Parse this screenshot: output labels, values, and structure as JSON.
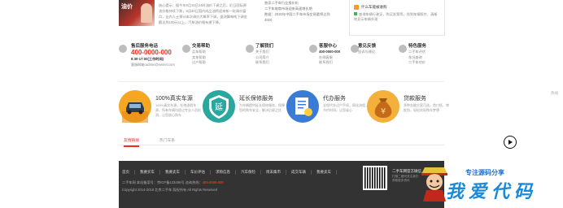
{
  "news": {
    "thumb_label": "油价",
    "body": "核心提示：据今年9月16日24时油价下调之后，近日国际原油价格持续下跌，9月30日国内成品油将迎来新一轮调价窗口，业内人士预计本次调价大概率下调，据测算每吨下调金额达到100元以上，汽柴油价格有望下降。",
    "mid_lines": [
      "独家二手车行业报价析",
      "二手车电商市场迎来高速增长期",
      "数据：2020年中国二手车市场交易量将达到",
      "4000"
    ],
    "side_title": "什么车能被收购",
    "side_desc": "查询车辆行驶证，购买发票等，找到车辆照片，清晰地显示车辆外观"
  },
  "service": {
    "hotline_title": "售后服务电话",
    "hotline_number": "400-0000-000",
    "hotline_hours": "8:30-17:00(工作时间)",
    "hotline_email": "客服邮箱:admin@ewnet.com",
    "trade_title": "交易帮助",
    "trade_items": [
      "买车帮助",
      "卖车帮助",
      "过户帮助"
    ],
    "about_title": "了解我们",
    "about_items": [
      "关于我们",
      "公司简介",
      "联系我们"
    ],
    "center_title": "客服中心",
    "center_number": "400-0000-000",
    "center_items": [
      "在线客服",
      "联系我们"
    ],
    "feedback_title": "意见反馈",
    "feedback_items": [
      "投诉与建议"
    ],
    "special_title": "特色服务",
    "special_items": [
      "二手车评估",
      "车况查询",
      "二手车估价"
    ]
  },
  "features": [
    {
      "title": "100%真实车源",
      "desc": "100%真实车源，杜绝虚假车源，所有车辆均经过专业人员检测，让您放心购车"
    },
    {
      "title": "延长保修服务",
      "desc": "为车辆提供延长保修服务，保障您的购车安全，解决后顾之忧"
    },
    {
      "title": "代办服务",
      "desc": "全程代办过户手续，简化流程，节约时间，让您省心"
    },
    {
      "title": "贷款服务",
      "desc": "多种金融方案可选，首付低、审批快，轻松实现购车梦想"
    }
  ],
  "hotline_note": "热线",
  "tabs": [
    {
      "label": "友情链接",
      "active": true
    },
    {
      "label": "热门车系",
      "active": false
    }
  ],
  "footer": {
    "nav": [
      "首页",
      "我要买车",
      "我要卖车",
      "车价评估",
      "求购信息",
      "汽车保险",
      "周末集市",
      "成交车辆",
      "我要卖车"
    ],
    "line1_prefix": "二手车网 本站备案号：京ICP备123456号   咨询热线：",
    "line1_phone": "400-0000-000",
    "line2": "Copyright 2014-2018 北京二手车 版权所有  All Rights Reserved",
    "qr_title": "二手车网官方微信",
    "qr_lines": [
      "扫描二维码关注我们",
      "获取更多资讯"
    ]
  },
  "watermark": {
    "sub": "专注源码分享",
    "main": "我爱代码"
  },
  "colors": {
    "accent_red": "#e8321f",
    "footer_bg": "#333333",
    "feature_orange": "#f5a623",
    "feature_teal": "#2aa8a0",
    "feature_blue": "#3a7bd5",
    "feature_gold": "#f3b13c"
  }
}
